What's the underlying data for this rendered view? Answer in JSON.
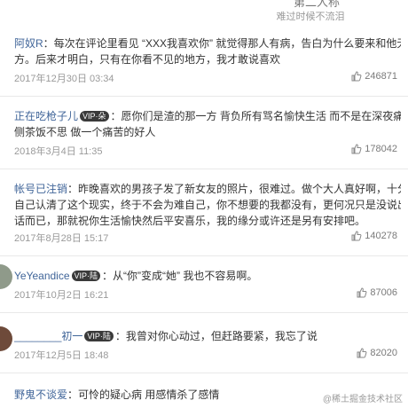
{
  "header": {
    "title": "第二人称",
    "subtitle": "难过时候不流泪"
  },
  "comments": [
    {
      "user": "阿奴R",
      "badge": "",
      "line1": "：每次在评论里看见 “XXX我喜欢你” 就觉得那人有病，告白为什么要来和他无关的地",
      "line2": "方。后来才明白，只有在你看不见的地方，我才敢说喜欢",
      "line3": "",
      "time": "2017年12月30日 03:34",
      "likes": "246871"
    },
    {
      "user": "正在吃枪子儿",
      "badge": "VIP·朵",
      "line1": "：愿你们是渣的那一方 背负所有骂名愉快生活 而不是在深夜痛哭 辗转反",
      "line2": "侧茶饭不思 做一个痛苦的好人",
      "line3": "",
      "time": "2018年3月4日 11:35",
      "likes": "178042"
    },
    {
      "user": "帐号已注销",
      "badge": "",
      "line1": "：昨晚喜欢的男孩子发了新女友的照片，很难过。做个大人真好啊，十分钟就能让",
      "line2": "自己认清了这个现实，终于不会为难自己，你不想要的我都没有，更何况只是没说出来的几句",
      "line3": "话而已，那就祝你生活愉快然后平安喜乐，我的缘分或许还是另有安排吧。",
      "time": "2017年8月28日 15:17",
      "likes": "140278"
    },
    {
      "user": "YeYeandice",
      "badge": "VIP·陆",
      "line1": "：从“你”变成“她” 我也不容易啊。",
      "line2": "",
      "line3": "",
      "time": "2017年10月2日 16:21",
      "likes": "87006"
    },
    {
      "user": "________初一",
      "badge": "VIP·陆",
      "line1": "：我曾对你心动过，但赶路要紧，我忘了说",
      "line2": "",
      "line3": "",
      "time": "2017年12月5日 18:48",
      "likes": "82020"
    },
    {
      "user": "野鬼不谈爱",
      "badge": "",
      "line1": "：可怜的疑心病 用感情杀了感情",
      "line2": "",
      "line3": "",
      "time": "",
      "likes": ""
    }
  ],
  "watermark": "@稀土掘金技术社区",
  "colors": {
    "username": "#406599",
    "text": "#333333",
    "meta": "#9a9a9a",
    "badge_bg": "#3a3a3a"
  },
  "icons": {
    "like": "thumbs-up-icon"
  }
}
